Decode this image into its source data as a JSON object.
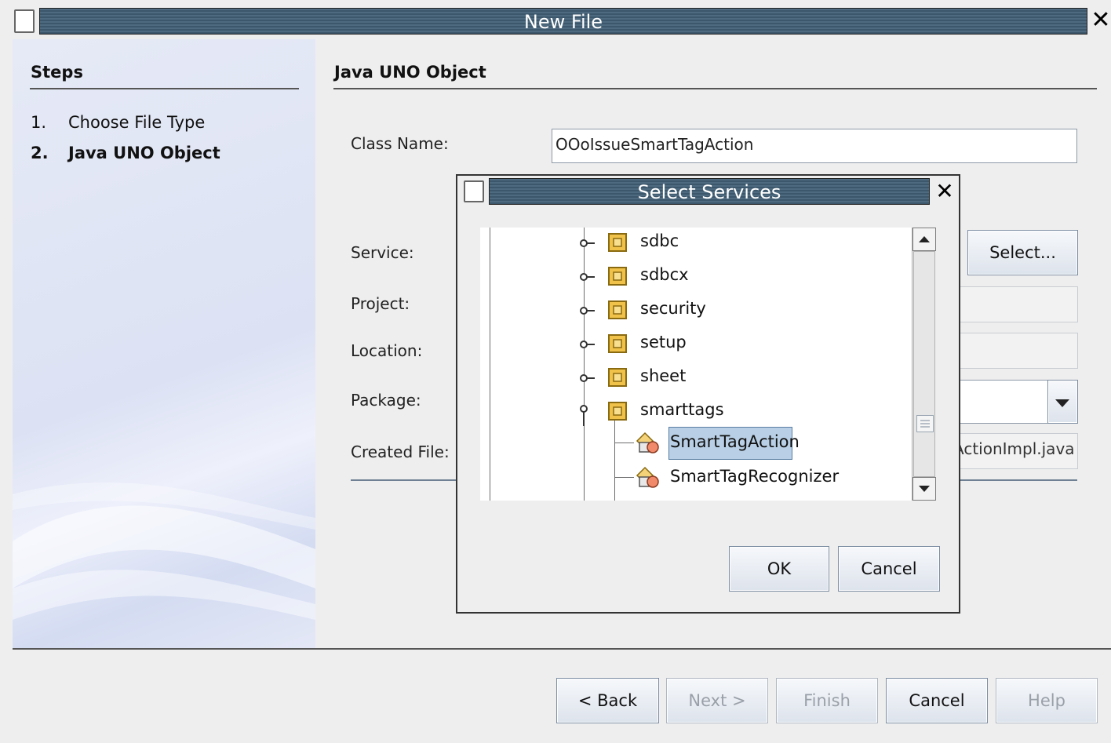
{
  "window": {
    "title": "New File"
  },
  "steps": {
    "title": "Steps",
    "items": [
      {
        "number": "1.",
        "label": "Choose File Type"
      },
      {
        "number": "2.",
        "label": "Java UNO Object"
      }
    ]
  },
  "form": {
    "heading": "Java UNO Object",
    "class_name_label": "Class Name:",
    "class_name_value": "OOoIssueSmartTagAction",
    "service_label": "Service:",
    "select_button": "Select...",
    "project_label": "Project:",
    "location_label": "Location:",
    "package_label": "Package:",
    "created_file_label": "Created File:",
    "created_file_value": "ActionImpl.java"
  },
  "footer": {
    "back": "< Back",
    "next": "Next >",
    "finish": "Finish",
    "cancel": "Cancel",
    "help": "Help"
  },
  "dialog": {
    "title": "Select Services",
    "tree": [
      {
        "label": "sdbc",
        "icon": "package-icon"
      },
      {
        "label": "sdbcx",
        "icon": "package-icon"
      },
      {
        "label": "security",
        "icon": "package-icon"
      },
      {
        "label": "setup",
        "icon": "package-icon"
      },
      {
        "label": "sheet",
        "icon": "package-icon"
      },
      {
        "label": "smarttags",
        "icon": "package-icon",
        "expanded": true
      },
      {
        "label": "SmartTagAction",
        "icon": "service-icon",
        "selected": true
      },
      {
        "label": "SmartTagRecognizer",
        "icon": "service-icon"
      }
    ],
    "ok": "OK",
    "cancel": "Cancel"
  },
  "colors": {
    "titlebar": "#3f5a6e",
    "selection": "#b8cfe5",
    "panel": "#dde3f4"
  }
}
